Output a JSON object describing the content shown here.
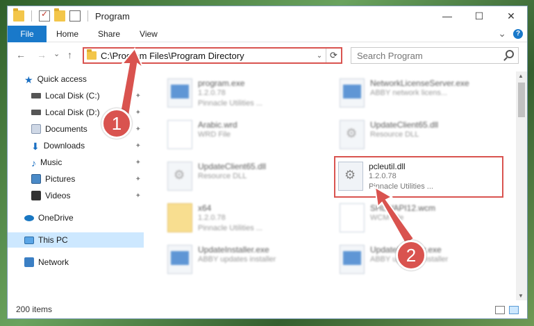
{
  "window": {
    "title": "Program"
  },
  "titlebar": {
    "minimize": "—",
    "maximize": "☐",
    "close": "✕"
  },
  "ribbon": {
    "tabs": [
      "File",
      "Home",
      "Share",
      "View"
    ],
    "expand_glyph": "⌄",
    "help_glyph": "?"
  },
  "nav": {
    "back": "←",
    "forward": "→",
    "recent": "⌄",
    "up": "↑",
    "address": "C:\\Program Files\\Program Directory",
    "address_drop": "⌄",
    "refresh": "⟳",
    "search_placeholder": "Search Program"
  },
  "sidebar": {
    "items": [
      {
        "label": "Quick access",
        "icon": "star-icon"
      },
      {
        "label": "Local Disk (C:)",
        "icon": "disk-icon",
        "pinned": true
      },
      {
        "label": "Local Disk (D:)",
        "icon": "disk-icon",
        "pinned": true
      },
      {
        "label": "Documents",
        "icon": "documents-icon",
        "pinned": true
      },
      {
        "label": "Downloads",
        "icon": "download-icon",
        "pinned": true
      },
      {
        "label": "Music",
        "icon": "music-icon",
        "pinned": true
      },
      {
        "label": "Pictures",
        "icon": "pictures-icon",
        "pinned": true
      },
      {
        "label": "Videos",
        "icon": "videos-icon",
        "pinned": true
      },
      {
        "label": "OneDrive",
        "icon": "cloud-icon"
      },
      {
        "label": "This PC",
        "icon": "pc-icon",
        "selected": true
      },
      {
        "label": "Network",
        "icon": "network-icon"
      }
    ],
    "pin_glyph": "📌"
  },
  "files": [
    {
      "name": "program.exe",
      "line1": "1.2.0.78",
      "line2": "Pinnacle Utilities ...",
      "icon": "exe",
      "blurred": true
    },
    {
      "name": "NetworkLicenseServer.exe",
      "line1": "ABBY network licens...",
      "line2": "",
      "icon": "exe",
      "blurred": true
    },
    {
      "name": "Arabic.wrd",
      "line1": "WRD File",
      "line2": "",
      "icon": "wrd",
      "blurred": true
    },
    {
      "name": "UpdateClient65.dll",
      "line1": "Resource DLL",
      "line2": "",
      "icon": "gear",
      "blurred": true
    },
    {
      "name": "UpdateClient65.dll",
      "line1": "Resource DLL",
      "line2": "",
      "icon": "gear",
      "blurred": true
    },
    {
      "name": "pcleutil.dll",
      "line1": "1.2.0.78",
      "line2": "Pinnacle Utilities ...",
      "icon": "gear",
      "blurred": false,
      "highlighted": true
    },
    {
      "name": "x64",
      "line1": "1.2.0.78",
      "line2": "Pinnacle Utilities ...",
      "icon": "folder",
      "blurred": true
    },
    {
      "name": "SHLWAPI12.wcm",
      "line1": "WCM File",
      "line2": "",
      "icon": "wrd",
      "blurred": true
    },
    {
      "name": "UpdateInstaller.exe",
      "line1": "ABBY updates installer",
      "line2": "",
      "icon": "exe",
      "blurred": true
    },
    {
      "name": "UpdateInstaller.exe",
      "line1": "ABBY updates installer",
      "line2": "",
      "icon": "exe",
      "blurred": true
    }
  ],
  "status": {
    "count": "200 items"
  },
  "callouts": [
    "1",
    "2"
  ],
  "colors": {
    "accent": "#1979ca",
    "callout": "#d9534f",
    "selected": "#cde8ff"
  }
}
